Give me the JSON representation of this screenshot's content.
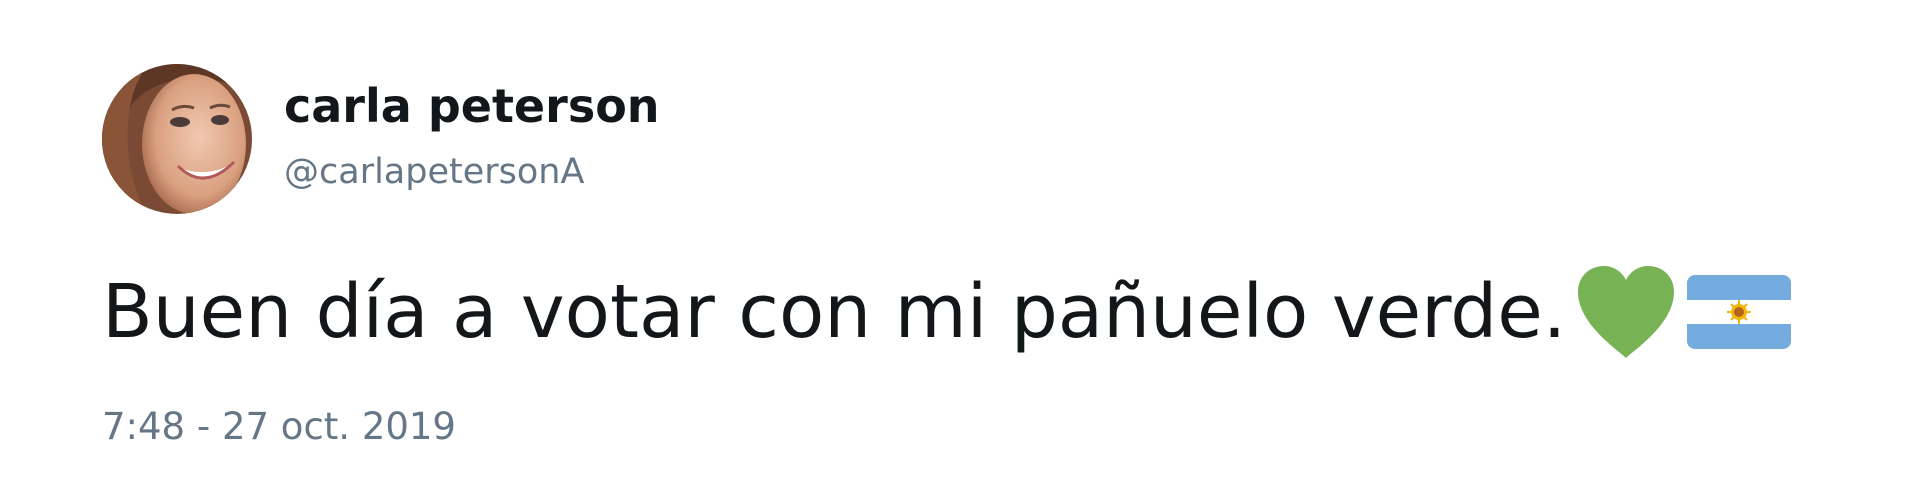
{
  "tweet": {
    "display_name": "carla peterson",
    "handle": "@carlapetersonA",
    "text": "Buen día a votar con mi pañuelo verde.",
    "emojis": [
      "green-heart-icon",
      "argentina-flag-icon"
    ],
    "timestamp": "7:48 - 27 oct. 2019"
  },
  "colors": {
    "text_primary": "#14171a",
    "text_secondary": "#657786",
    "green_heart": "#77b255",
    "flag_blue": "#74acdf",
    "flag_white": "#ffffff",
    "flag_sun": "#f6b40e"
  }
}
